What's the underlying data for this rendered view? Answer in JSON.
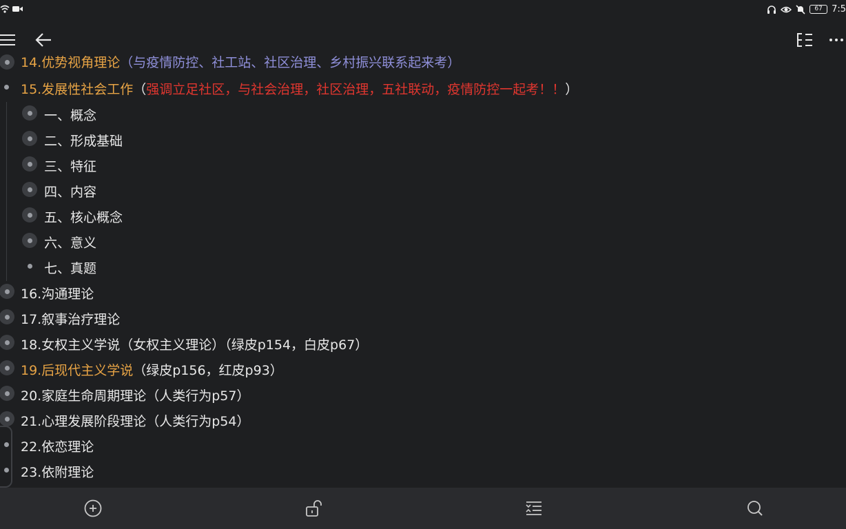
{
  "status": {
    "time": "7:5",
    "battery": "67"
  },
  "toolbar": {
    "menu_icon": "menu-icon",
    "back_icon": "back-arrow-icon",
    "outline_icon": "outline-toggle-icon",
    "more_icon": "more-icon"
  },
  "outline": {
    "item14": {
      "title": "14.优势视角理论",
      "note": "（与疫情防控、社工站、社区治理、乡村振兴联系起来考）"
    },
    "item15": {
      "title": "15.发展性社会工作",
      "note_open": "（",
      "note": "强调立足社区，与社会治理，社区治理，五社联动，疫情防控一起考！！",
      "note_close": "）"
    },
    "children15": [
      "一、概念",
      "二、形成基础",
      "三、特征",
      "四、内容",
      "五、核心概念",
      "六、意义",
      "七、真题"
    ],
    "item16": "16.沟通理论",
    "item17": "17.叙事治疗理论",
    "item18": "18.女权主义学说（女权主义理论）（绿皮p154，白皮p67）",
    "item19": {
      "title": "19.后现代主义学说",
      "note": "（绿皮p156，红皮p93）"
    },
    "item20": "20.家庭生命周期理论（人类行为p57）",
    "item21": "21.心理发展阶段理论（人类行为p54）",
    "item22": "22.依恋理论",
    "item23": "23.依附理论"
  },
  "colors": {
    "accent_orange": "#e8a445",
    "accent_red": "#e0362f",
    "dim_blue": "#8f8fd9"
  },
  "bottombar": {
    "icons": [
      "add-circle-icon",
      "unlock-icon",
      "adjust-indent-icon",
      "search-icon"
    ]
  }
}
